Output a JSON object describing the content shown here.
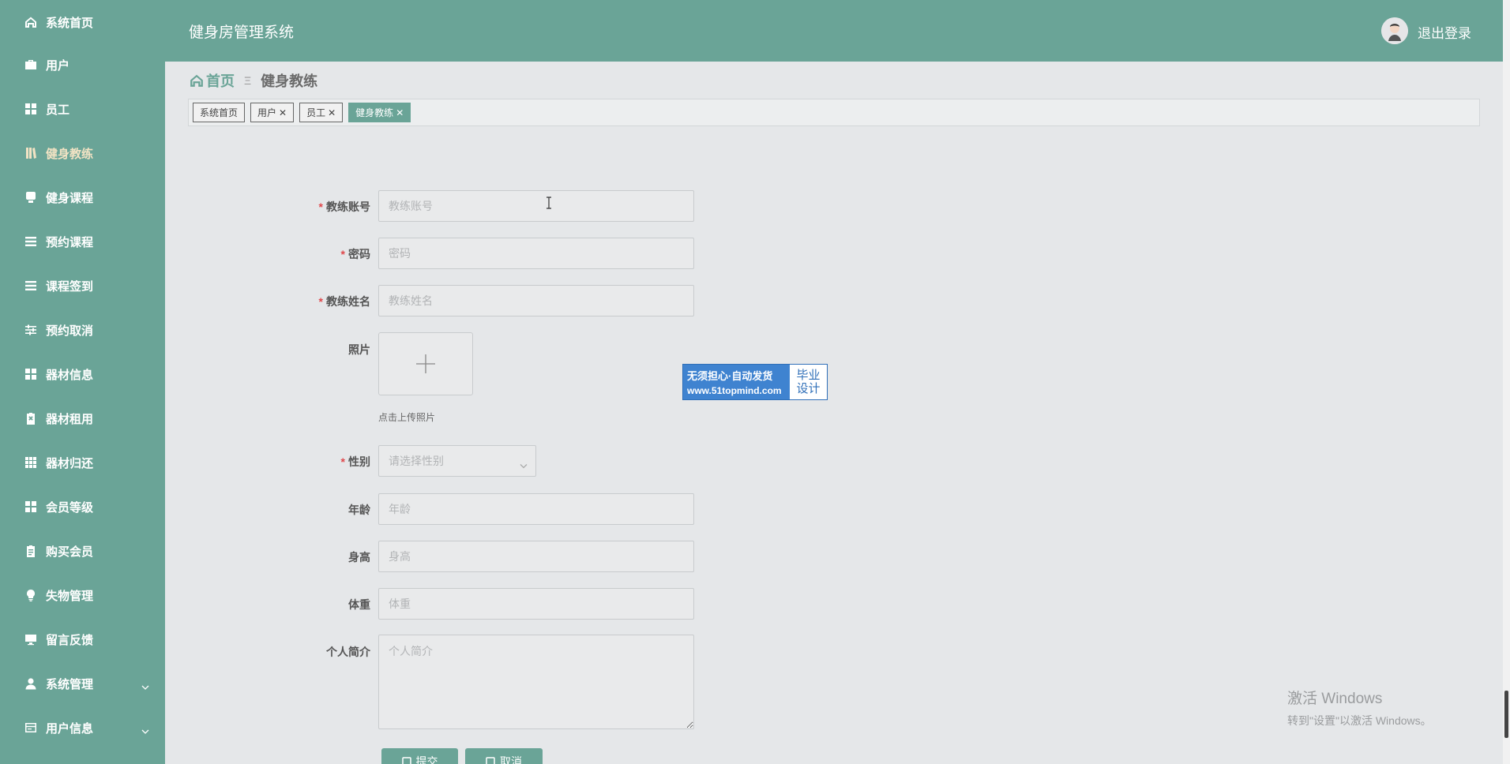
{
  "app": {
    "title": "健身房管理系统",
    "logout_label": "退出登录"
  },
  "sidebar": {
    "items": [
      {
        "label": "系统首页",
        "icon": "home-icon"
      },
      {
        "label": "用户",
        "icon": "briefcase-icon"
      },
      {
        "label": "员工",
        "icon": "grid-icon"
      },
      {
        "label": "健身教练",
        "icon": "book-icon",
        "active": true
      },
      {
        "label": "健身课程",
        "icon": "monitor-icon"
      },
      {
        "label": "预约课程",
        "icon": "list-icon"
      },
      {
        "label": "课程签到",
        "icon": "list-icon"
      },
      {
        "label": "预约取消",
        "icon": "sliders-icon"
      },
      {
        "label": "器材信息",
        "icon": "grid-icon"
      },
      {
        "label": "器材租用",
        "icon": "clipboard-x-icon"
      },
      {
        "label": "器材归还",
        "icon": "apps-icon"
      },
      {
        "label": "会员等级",
        "icon": "grid-icon"
      },
      {
        "label": "购买会员",
        "icon": "clipboard-icon"
      },
      {
        "label": "失物管理",
        "icon": "bulb-icon"
      },
      {
        "label": "留言反馈",
        "icon": "monitor-icon"
      },
      {
        "label": "系统管理",
        "icon": "user-icon",
        "expandable": true
      },
      {
        "label": "用户信息",
        "icon": "card-icon",
        "expandable": true
      }
    ]
  },
  "breadcrumb": {
    "home": "首页",
    "separator": "Ξ",
    "current": "健身教练"
  },
  "tags": [
    {
      "label": "系统首页",
      "closable": false
    },
    {
      "label": "用户",
      "closable": true
    },
    {
      "label": "员工",
      "closable": true
    },
    {
      "label": "健身教练",
      "closable": true,
      "active": true
    }
  ],
  "form": {
    "account": {
      "label": "教练账号",
      "placeholder": "教练账号",
      "required": true,
      "value": ""
    },
    "password": {
      "label": "密码",
      "placeholder": "密码",
      "required": true,
      "value": ""
    },
    "name": {
      "label": "教练姓名",
      "placeholder": "教练姓名",
      "required": true,
      "value": ""
    },
    "photo": {
      "label": "照片",
      "hint": "点击上传照片"
    },
    "gender": {
      "label": "性别",
      "placeholder": "请选择性别",
      "required": true
    },
    "age": {
      "label": "年龄",
      "placeholder": "年龄",
      "value": ""
    },
    "height": {
      "label": "身高",
      "placeholder": "身高",
      "value": ""
    },
    "weight": {
      "label": "体重",
      "placeholder": "体重",
      "value": ""
    },
    "intro": {
      "label": "个人简介",
      "placeholder": "个人简介",
      "value": ""
    },
    "submit_label": "提交",
    "cancel_label": "取消"
  },
  "watermark_badge": {
    "line1": "无须担心·自动发货",
    "line2": "www.51topmind.com",
    "right1": "毕业",
    "right2": "设计"
  },
  "windows_activation": {
    "title": "激活 Windows",
    "subtitle": "转到\"设置\"以激活 Windows。"
  },
  "colors": {
    "primary": "#6aa497",
    "background": "#e5e7e9",
    "active_menu_text": "#f2e3c4",
    "required": "#e0484c"
  }
}
